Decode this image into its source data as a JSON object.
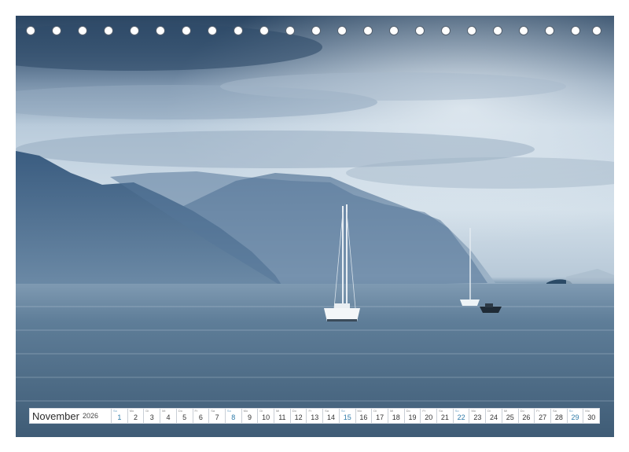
{
  "calendar": {
    "month": "November",
    "year": "2026",
    "days": [
      {
        "num": "1",
        "wd": "So",
        "weekend": true
      },
      {
        "num": "2",
        "wd": "Mo",
        "weekend": false
      },
      {
        "num": "3",
        "wd": "Di",
        "weekend": false
      },
      {
        "num": "4",
        "wd": "Mi",
        "weekend": false
      },
      {
        "num": "5",
        "wd": "Do",
        "weekend": false
      },
      {
        "num": "6",
        "wd": "Fr",
        "weekend": false
      },
      {
        "num": "7",
        "wd": "Sa",
        "weekend": false
      },
      {
        "num": "8",
        "wd": "So",
        "weekend": true
      },
      {
        "num": "9",
        "wd": "Mo",
        "weekend": false
      },
      {
        "num": "10",
        "wd": "Di",
        "weekend": false
      },
      {
        "num": "11",
        "wd": "Mi",
        "weekend": false
      },
      {
        "num": "12",
        "wd": "Do",
        "weekend": false
      },
      {
        "num": "13",
        "wd": "Fr",
        "weekend": false
      },
      {
        "num": "14",
        "wd": "Sa",
        "weekend": false
      },
      {
        "num": "15",
        "wd": "So",
        "weekend": true
      },
      {
        "num": "16",
        "wd": "Mo",
        "weekend": false
      },
      {
        "num": "17",
        "wd": "Di",
        "weekend": false
      },
      {
        "num": "18",
        "wd": "Mi",
        "weekend": false
      },
      {
        "num": "19",
        "wd": "Do",
        "weekend": false
      },
      {
        "num": "20",
        "wd": "Fr",
        "weekend": false
      },
      {
        "num": "21",
        "wd": "Sa",
        "weekend": false
      },
      {
        "num": "22",
        "wd": "So",
        "weekend": true
      },
      {
        "num": "23",
        "wd": "Mo",
        "weekend": false
      },
      {
        "num": "24",
        "wd": "Di",
        "weekend": false
      },
      {
        "num": "25",
        "wd": "Mi",
        "weekend": false
      },
      {
        "num": "26",
        "wd": "Do",
        "weekend": false
      },
      {
        "num": "27",
        "wd": "Fr",
        "weekend": false
      },
      {
        "num": "28",
        "wd": "Sa",
        "weekend": false
      },
      {
        "num": "29",
        "wd": "So",
        "weekend": true
      },
      {
        "num": "30",
        "wd": "Mo",
        "weekend": false
      }
    ]
  },
  "colors": {
    "weekend": "#2d7aa8",
    "water": "#4c6a84",
    "mountains": "#3f6182",
    "sky": "#c7d6e3"
  },
  "photo": {
    "subject": "Sailboats on a lake below mountains under cloudy sky"
  }
}
